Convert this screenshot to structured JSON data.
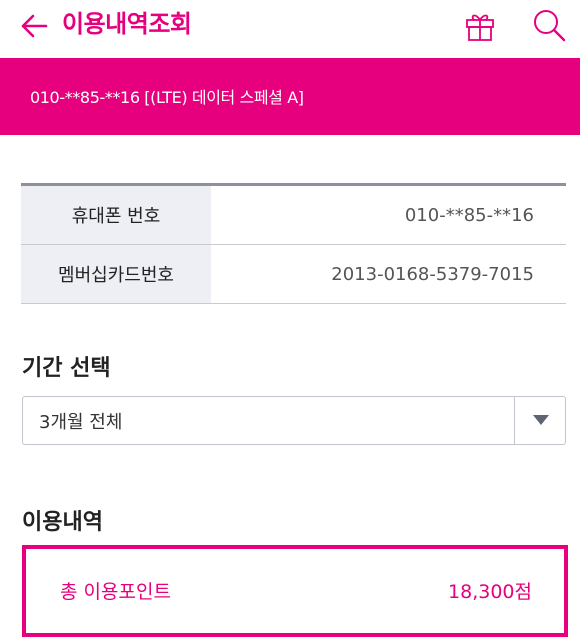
{
  "header": {
    "title": "이용내역조회",
    "back_icon": "arrow-left-icon",
    "gift_icon": "gift-icon",
    "search_icon": "search-icon"
  },
  "banner": {
    "text": "010-**85-**16 [(LTE) 데이터 스페셜 A]"
  },
  "info_table": {
    "rows": [
      {
        "label": "휴대폰 번호",
        "value": "010-**85-**16"
      },
      {
        "label": "멤버십카드번호",
        "value": "2013-0168-5379-7015"
      }
    ]
  },
  "period": {
    "title": "기간 선택",
    "selected": "3개월 전체"
  },
  "usage": {
    "title": "이용내역",
    "total_label": "총 이용포인트",
    "total_value": "18,300점"
  },
  "colors": {
    "accent": "#e6007e",
    "table_label_bg": "#eeeff5",
    "border": "#c2c5cc"
  }
}
